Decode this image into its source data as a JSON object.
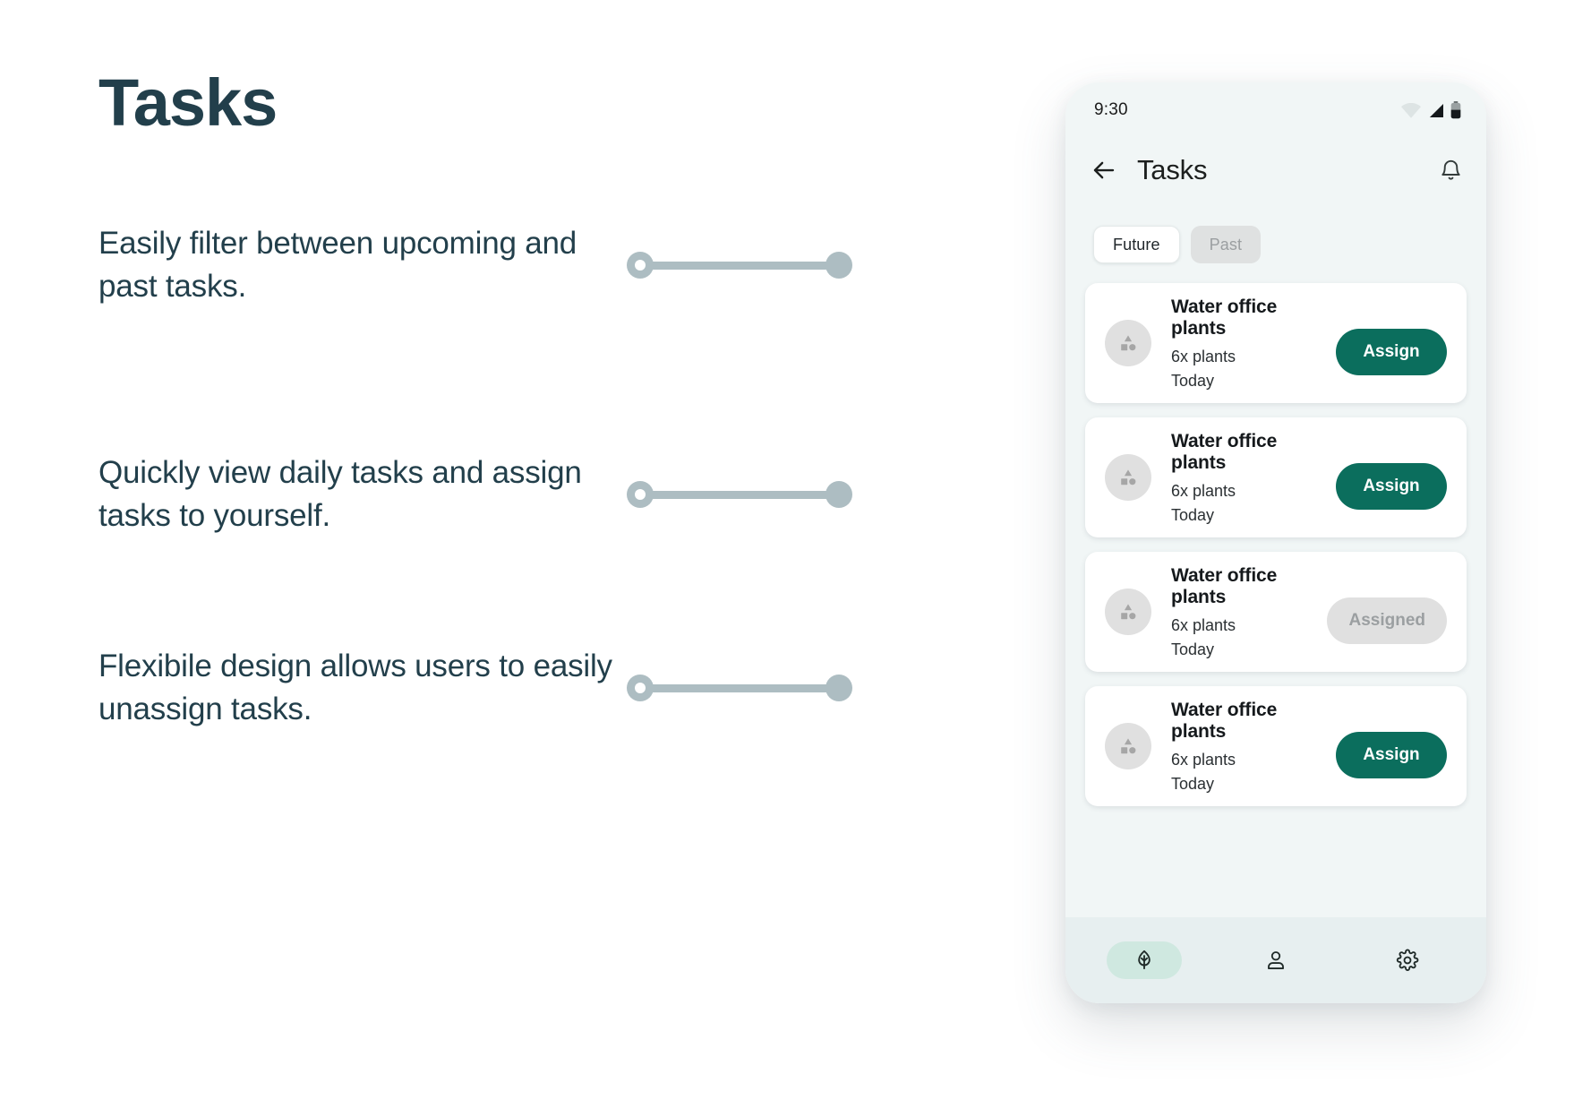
{
  "page": {
    "title": "Tasks",
    "features": [
      {
        "text": "Easily filter between upcoming and past tasks."
      },
      {
        "text": "Quickly view daily tasks and assign tasks to yourself."
      },
      {
        "text": "Flexibile design allows users to easily unassign tasks."
      }
    ]
  },
  "colors": {
    "title": "#223f4b",
    "body": "#223f4b",
    "connector": "#adbdc2",
    "accent": "#0b6e5d",
    "screen_bg": "#f1f6f6",
    "nav_bg": "#e7eff0",
    "nav_active_pill": "#cfe8e0",
    "disabled": "#e0e0e0",
    "disabled_text": "#9b9fa1"
  },
  "phone": {
    "status": {
      "time": "9:30",
      "wifi_icon": "wifi-icon",
      "signal_icon": "cell-signal-icon",
      "battery_icon": "battery-icon"
    },
    "app_bar": {
      "back_icon": "arrow-left-icon",
      "title": "Tasks",
      "bell_icon": "notification-bell-icon"
    },
    "filters": [
      {
        "label": "Future",
        "state": "active"
      },
      {
        "label": "Past",
        "state": "inactive"
      }
    ],
    "tasks": [
      {
        "title": "Water office plants",
        "subtitle": "6x plants",
        "when": "Today",
        "avatar_icon": "shapes-avatar-icon",
        "action_label": "Assign",
        "action_state": "enabled"
      },
      {
        "title": "Water office plants",
        "subtitle": "6x plants",
        "when": "Today",
        "avatar_icon": "shapes-avatar-icon",
        "action_label": "Assign",
        "action_state": "enabled"
      },
      {
        "title": "Water office plants",
        "subtitle": "6x plants",
        "when": "Today",
        "avatar_icon": "shapes-avatar-icon",
        "action_label": "Assigned",
        "action_state": "disabled"
      },
      {
        "title": "Water office plants",
        "subtitle": "6x plants",
        "when": "Today",
        "avatar_icon": "shapes-avatar-icon",
        "action_label": "Assign",
        "action_state": "enabled"
      }
    ],
    "bottom_nav": [
      {
        "icon": "leaf-icon",
        "state": "active"
      },
      {
        "icon": "person-icon",
        "state": "inactive"
      },
      {
        "icon": "gear-icon",
        "state": "inactive"
      }
    ]
  }
}
